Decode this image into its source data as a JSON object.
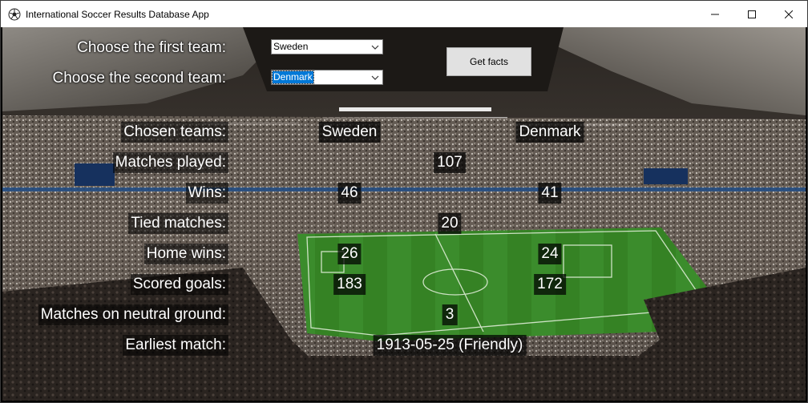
{
  "window": {
    "title": "International Soccer Results Database App"
  },
  "form": {
    "first_team_label": "Choose the first team:",
    "second_team_label": "Choose the second team:",
    "first_team_value": "Sweden",
    "second_team_value": "Denmark",
    "get_facts_label": "Get facts"
  },
  "results": {
    "chosen_teams_label": "Chosen teams:",
    "team1": "Sweden",
    "team2": "Denmark",
    "matches_played_label": "Matches played:",
    "matches_played": "107",
    "wins_label": "Wins:",
    "wins_team1": "46",
    "wins_team2": "41",
    "tied_label": "Tied matches:",
    "tied": "20",
    "home_wins_label": "Home wins:",
    "home_wins_team1": "26",
    "home_wins_team2": "24",
    "scored_goals_label": "Scored goals:",
    "goals_team1": "183",
    "goals_team2": "172",
    "neutral_label": "Matches on neutral ground:",
    "neutral": "3",
    "earliest_label": "Earliest match:",
    "earliest": "1913-05-25 (Friendly)"
  },
  "icons": {
    "app": "soccer-ball-icon",
    "minimize": "minimize-icon",
    "maximize": "maximize-icon",
    "close": "close-icon",
    "dropdown": "chevron-down-icon"
  },
  "colors": {
    "selection": "#0078d7",
    "pitch": "#3f8f2a",
    "label_bg": "#000000"
  }
}
